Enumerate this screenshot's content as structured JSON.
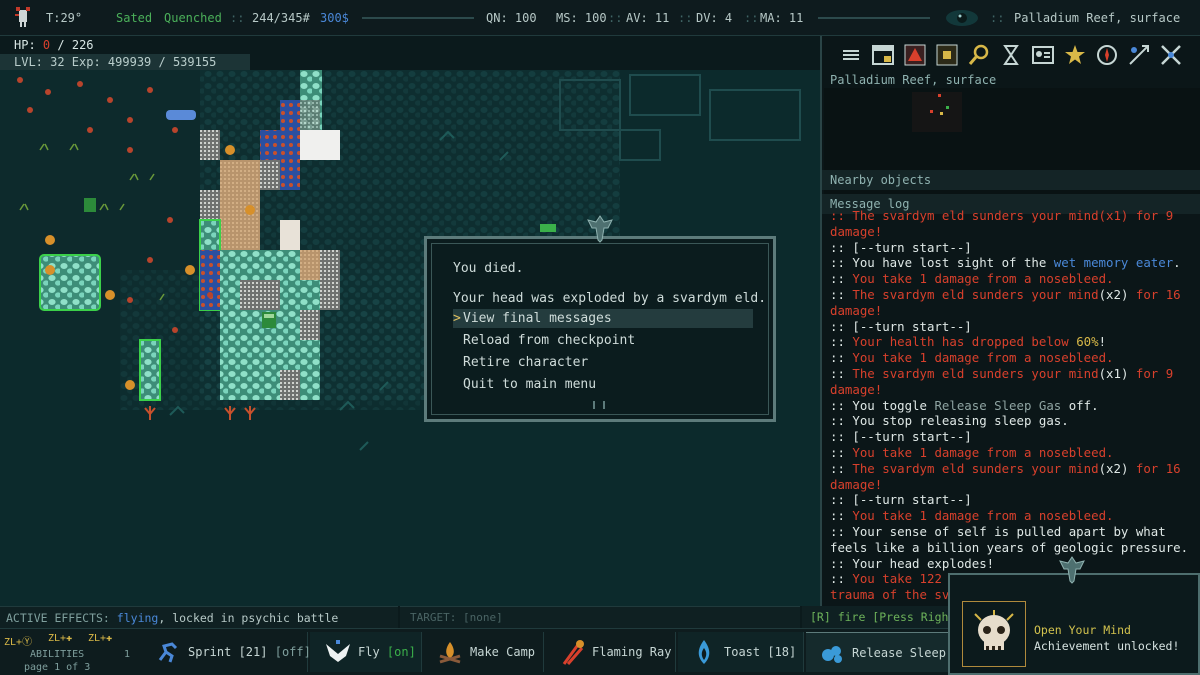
{
  "status": {
    "turn": "T:29°",
    "food": "Sated",
    "water": "Quenched",
    "weight": "244/345#",
    "money": "300$",
    "qn": "QN: 100",
    "ms": "MS: 100",
    "av": "AV: 11",
    "dv": "DV: 4",
    "ma": "MA: 11",
    "zone": "Palladium Reef, surface"
  },
  "hp": {
    "label": "HP:",
    "current": "0",
    "sep": "/",
    "max": "226"
  },
  "level": "LVL: 32 Exp: 499939 / 539155",
  "dialog": {
    "title": "You died.",
    "cause": "Your head was exploded by a svardym eld.",
    "options": [
      "View final messages",
      "Reload from checkpoint",
      "Retire character",
      "Quit to main menu"
    ],
    "selected_marker": ">"
  },
  "panel": {
    "minimap_label": "Palladium Reef, surface",
    "nearby_label": "Nearby objects",
    "log_label": "Message log"
  },
  "log": [
    [
      {
        "t": ":: The svardym eld sunders your mind(x1) for 9",
        "c": "red"
      }
    ],
    [
      {
        "t": "damage!",
        "c": "red"
      }
    ],
    [
      {
        "t": ":: [--turn start--]",
        "c": ""
      }
    ],
    [
      {
        "t": ":: You have lost sight of the ",
        "c": ""
      },
      {
        "t": "wet memory eater",
        "c": "blue"
      },
      {
        "t": ".",
        "c": ""
      }
    ],
    [
      {
        "t": ":: ",
        "c": ""
      },
      {
        "t": "You take 1 damage from a nosebleed.",
        "c": "red"
      }
    ],
    [
      {
        "t": ":: ",
        "c": ""
      },
      {
        "t": "The svardym eld sunders your mind",
        "c": "red"
      },
      {
        "t": "(x2)",
        "c": ""
      },
      {
        "t": " for 16",
        "c": "red"
      }
    ],
    [
      {
        "t": "damage!",
        "c": "red"
      }
    ],
    [
      {
        "t": ":: [--turn start--]",
        "c": ""
      }
    ],
    [
      {
        "t": ":: ",
        "c": ""
      },
      {
        "t": "Your health has dropped below ",
        "c": "red"
      },
      {
        "t": "60%",
        "c": "gold"
      },
      {
        "t": "!",
        "c": ""
      }
    ],
    [
      {
        "t": ":: ",
        "c": ""
      },
      {
        "t": "You take 1 damage from a nosebleed.",
        "c": "red"
      }
    ],
    [
      {
        "t": ":: ",
        "c": ""
      },
      {
        "t": "The svardym eld sunders your mind",
        "c": "red"
      },
      {
        "t": "(x1)",
        "c": ""
      },
      {
        "t": " for 9",
        "c": "red"
      }
    ],
    [
      {
        "t": "damage!",
        "c": "red"
      }
    ],
    [
      {
        "t": ":: You toggle ",
        "c": ""
      },
      {
        "t": "Release Sleep Gas",
        "c": "grey"
      },
      {
        "t": " off.",
        "c": ""
      }
    ],
    [
      {
        "t": ":: You stop releasing sleep gas.",
        "c": ""
      }
    ],
    [
      {
        "t": ":: [--turn start--]",
        "c": ""
      }
    ],
    [
      {
        "t": ":: ",
        "c": ""
      },
      {
        "t": "You take 1 damage from a nosebleed.",
        "c": "red"
      }
    ],
    [
      {
        "t": ":: ",
        "c": ""
      },
      {
        "t": "The svardym eld sunders your mind",
        "c": "red"
      },
      {
        "t": "(x2)",
        "c": ""
      },
      {
        "t": " for 16",
        "c": "red"
      }
    ],
    [
      {
        "t": "damage!",
        "c": "red"
      }
    ],
    [
      {
        "t": ":: [--turn start--]",
        "c": ""
      }
    ],
    [
      {
        "t": ":: ",
        "c": ""
      },
      {
        "t": "You take 1 damage from a nosebleed.",
        "c": "red"
      }
    ],
    [
      {
        "t": ":: Your sense of self is pulled apart by what",
        "c": ""
      }
    ],
    [
      {
        "t": "feels like a billion years of geologic pressure.",
        "c": ""
      }
    ],
    [
      {
        "t": ":: Your head explodes!",
        "c": ""
      }
    ],
    [
      {
        "t": ":: ",
        "c": ""
      },
      {
        "t": "You take 122",
        "c": "red"
      }
    ],
    [
      {
        "t": "trauma of the sv",
        "c": "red"
      }
    ]
  ],
  "effects": {
    "label": "ACTIVE EFFECTS:",
    "flying": "flying",
    "rest": ", locked in psychic battle"
  },
  "target": "TARGET: [none]",
  "fire": "[R] fire [Press Right",
  "abilities_nav": {
    "hint1": "ZL+",
    "hint2": "ZL+",
    "hint3": "ZL+",
    "label": "ABILITIES",
    "page": "page 1 of 3",
    "num": "1"
  },
  "abilities": [
    {
      "name": "Sprint [21]",
      "state": "[off]",
      "icon": "sprint-icon"
    },
    {
      "name": "Fly",
      "state": "[on]",
      "icon": "fly-icon"
    },
    {
      "name": "Make Camp",
      "state": "",
      "icon": "campfire-icon"
    },
    {
      "name": "Flaming Ray",
      "state": "",
      "icon": "flame-icon"
    },
    {
      "name": "Toast [18]",
      "state": "",
      "icon": "toast-icon"
    },
    {
      "name": "Release Sleep G",
      "state": "",
      "icon": "sleep-gas-icon"
    }
  ],
  "achievement": {
    "title": "Open Your Mind",
    "subtitle": "Achievement unlocked!"
  },
  "colors": {
    "bg": "#0b1a1c",
    "red": "#d8402c",
    "blue": "#4a88d8",
    "gold": "#d8b848",
    "green": "#4bb05a"
  }
}
